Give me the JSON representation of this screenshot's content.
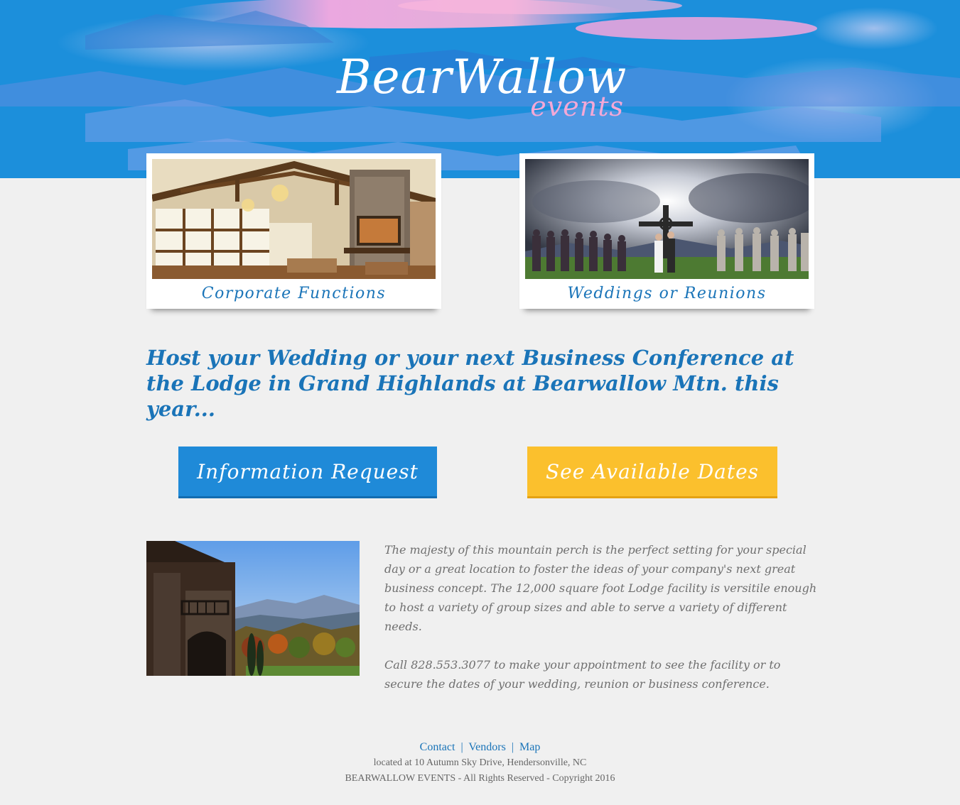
{
  "brand": {
    "name": "BearWallow",
    "subtitle": "events"
  },
  "features": [
    {
      "caption": "Corporate Functions"
    },
    {
      "caption": "Weddings or Reunions"
    }
  ],
  "tagline": "Host your Wedding or your next Business Conference at the Lodge in Grand Highlands at Bearwallow Mtn. this year...",
  "cta": {
    "info_label": "Information Request",
    "dates_label": "See Available Dates"
  },
  "body": {
    "paragraph1": "The majesty of this mountain perch is the perfect setting for your special day or a great location to foster the ideas of your company's next great business concept. The 12,000 square foot Lodge facility is versitile enough to host a variety of group sizes and able to serve a variety of different needs.",
    "paragraph2": "Call 828.553.3077 to make your appointment to see the facility or to secure the dates of your wedding, reunion or business conference."
  },
  "footer": {
    "links": [
      "Contact",
      "Vendors",
      "Map"
    ],
    "separator": "|",
    "address": "located at 10 Autumn Sky Drive, Hendersonville, NC",
    "copyright": "BEARWALLOW EVENTS - All Rights Reserved - Copyright 2016"
  },
  "colors": {
    "banner_blue": "#1c8fdb",
    "accent_pink": "#f4a8d6",
    "link_blue": "#1a74b8",
    "button_blue": "#1f8ad8",
    "button_yellow": "#fbc02d",
    "page_bg": "#f0f0f0",
    "body_text": "#6f6f6f"
  }
}
